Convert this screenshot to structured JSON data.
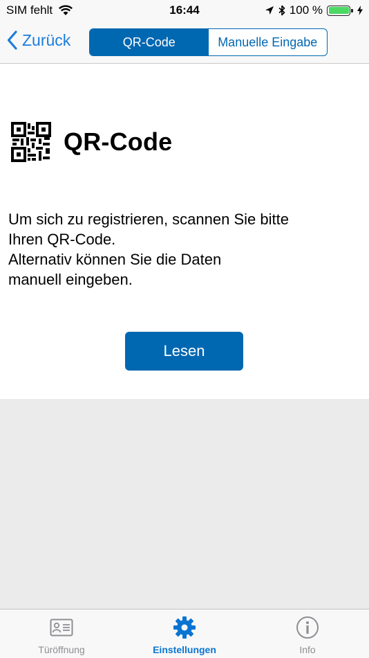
{
  "status_bar": {
    "carrier": "SIM fehlt",
    "time": "16:44",
    "battery": "100 %"
  },
  "nav": {
    "back_label": "Zurück",
    "segments": [
      {
        "label": "QR-Code",
        "active": true
      },
      {
        "label": "Manuelle Eingabe",
        "active": false
      }
    ]
  },
  "content": {
    "heading": "QR-Code",
    "description_lines": [
      "Um sich zu registrieren, scannen Sie bitte",
      "Ihren QR-Code.",
      "Alternativ können Sie die Daten",
      "manuell eingeben."
    ],
    "read_button": "Lesen"
  },
  "tab_bar": {
    "tabs": [
      {
        "label": "Türöffnung",
        "icon": "id-card-icon",
        "active": false
      },
      {
        "label": "Einstellungen",
        "icon": "gear-icon",
        "active": true
      },
      {
        "label": "Info",
        "icon": "info-icon",
        "active": false
      }
    ]
  },
  "colors": {
    "accent": "#0067b1",
    "back_link": "#1a7ddb",
    "inactive_tab": "#8e8e93",
    "battery": "#4cd964"
  }
}
